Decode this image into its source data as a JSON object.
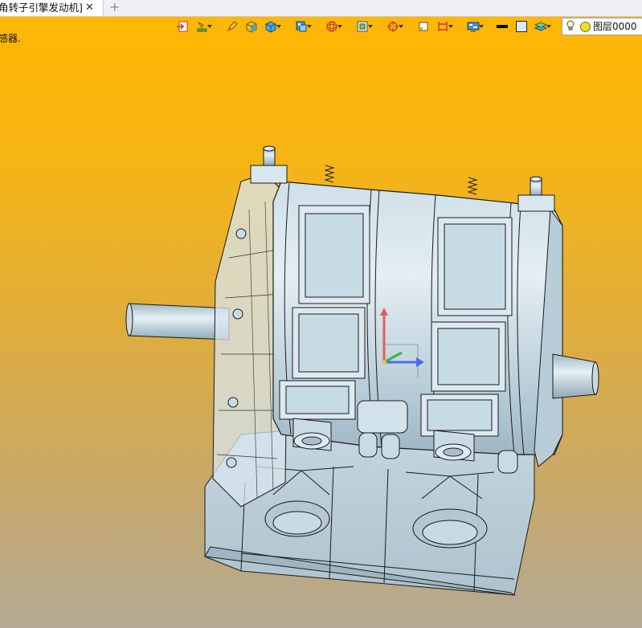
{
  "tab": {
    "title": "角转子引擎发动机]",
    "close_glyph": "✕",
    "add_glyph": "+"
  },
  "status": {
    "text": "感器."
  },
  "toolbar": {
    "icons": [
      "exit-sketch-icon",
      "lamp-icon",
      "pencil-icon",
      "shaded-cube-icon",
      "cube-view-icon",
      "render-mode-icon",
      "wireframe-sphere-icon",
      "frame-select-icon",
      "target-icon",
      "rectangle-icon",
      "dimension-icon",
      "display-settings-icon",
      "line-color-icon",
      "fill-color-icon",
      "layer-stack-icon"
    ],
    "colors": {
      "line": "#000000",
      "fill": "#d6e9f6"
    }
  },
  "layer": {
    "label": "图层0000",
    "bulb_icon": "bulb-icon",
    "status_color": "#e6df35"
  },
  "viewport": {
    "background_top": "#ffb703",
    "background_bottom": "#b4a994",
    "model_color": "#c9dce6",
    "model_edge_color": "#1a1a1a",
    "axes": [
      "x-axis",
      "y-axis",
      "z-axis"
    ]
  }
}
